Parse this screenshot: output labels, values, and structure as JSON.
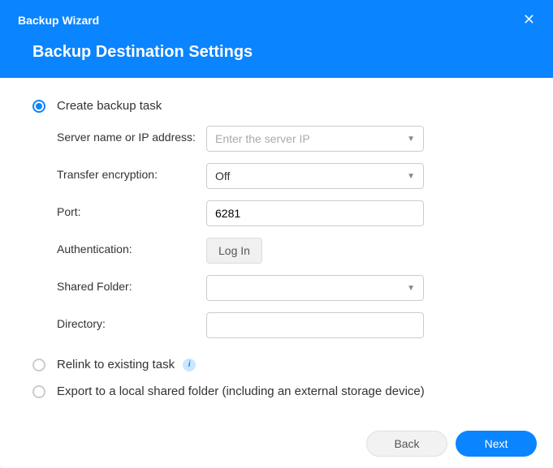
{
  "header": {
    "window_title": "Backup Wizard",
    "page_title": "Backup Destination Settings"
  },
  "options": {
    "create": {
      "label": "Create backup task",
      "selected": true
    },
    "relink": {
      "label": "Relink to existing task",
      "selected": false
    },
    "export": {
      "label": "Export to a local shared folder (including an external storage device)",
      "selected": false
    }
  },
  "form": {
    "server": {
      "label": "Server name or IP address:",
      "placeholder": "Enter the server IP",
      "value": ""
    },
    "encryption": {
      "label": "Transfer encryption:",
      "value": "Off"
    },
    "port": {
      "label": "Port:",
      "value": "6281"
    },
    "auth": {
      "label": "Authentication:",
      "button_label": "Log In"
    },
    "shared_folder": {
      "label": "Shared Folder:",
      "value": ""
    },
    "directory": {
      "label": "Directory:",
      "value": ""
    }
  },
  "footer": {
    "back": "Back",
    "next": "Next"
  }
}
